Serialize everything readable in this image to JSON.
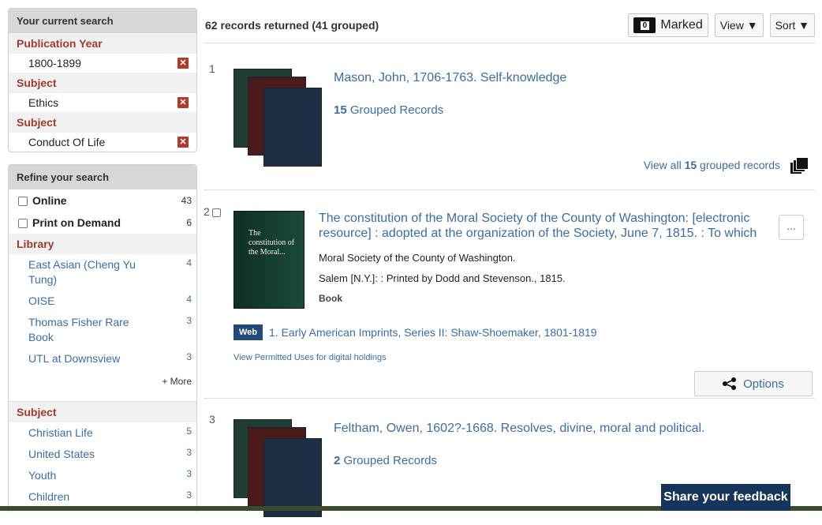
{
  "current_search": {
    "header": "Your current search",
    "criteria": [
      {
        "facet": "Publication Year",
        "value": "1800-1899"
      },
      {
        "facet": "Subject",
        "value": "Ethics"
      },
      {
        "facet": "Subject",
        "value": "Conduct Of Life"
      }
    ],
    "remove_glyph": "✕"
  },
  "refine": {
    "header": "Refine your search",
    "online": {
      "label": "Online",
      "count": "43"
    },
    "print_on_demand": {
      "label": "Print on Demand",
      "count": "6"
    },
    "library": {
      "title": "Library",
      "items": [
        {
          "label": "East Asian (Cheng Yu Tung)",
          "count": "4"
        },
        {
          "label": "OISE",
          "count": "4"
        },
        {
          "label": "Thomas Fisher Rare Book",
          "count": "3"
        },
        {
          "label": "UTL at Downsview",
          "count": "3"
        }
      ],
      "more": "+ More"
    },
    "subject": {
      "title": "Subject",
      "items": [
        {
          "label": "Christian Life",
          "count": "5"
        },
        {
          "label": "United States",
          "count": "3"
        },
        {
          "label": "Youth",
          "count": "3"
        },
        {
          "label": "Children",
          "count": "3"
        }
      ]
    }
  },
  "results_header": {
    "count_text": "62 records returned (41 grouped)",
    "marked_count": "0",
    "marked_label": "Marked",
    "view_label": "View ▼",
    "sort_label": "Sort ▼"
  },
  "results": [
    {
      "num": "1",
      "title": "Mason, John, 1706-1763. Self-knowledge",
      "grouped_count": "15",
      "grouped_label": "Grouped Records",
      "view_all_prefix": "View all",
      "view_all_count": "15",
      "view_all_suffix": "grouped records"
    },
    {
      "num": "2",
      "title": "The constitution of the Moral Society of the County of Washington: [electronic resource] : adopted at the organization of the Society, June 7, 1815. : To which",
      "cover_text": "The constitution of the Moral...",
      "author": "Moral Society of the County of Washington.",
      "publisher": "Salem [N.Y.]: : Printed by Dodd and Stevenson., 1815.",
      "format": "Book",
      "web_tag": "Web",
      "web_link": "1. Early American Imprints, Series II: Shaw-Shoemaker, 1801-1819",
      "permitted_uses": "View Permitted Uses for digital holdings",
      "more_glyph": "...",
      "options_label": "Options"
    },
    {
      "num": "3",
      "title": "Feltham, Owen, 1602?-1668. Resolves, divine, moral and political.",
      "grouped_count": "2",
      "grouped_label": "Grouped Records"
    }
  ],
  "feedback": "Share your feedback",
  "colors": {
    "facet_red": "#a33b2a",
    "link_blue": "#3a6ea5",
    "feedback_bg": "#14345a",
    "web_tag_bg": "#1f4b7a"
  }
}
